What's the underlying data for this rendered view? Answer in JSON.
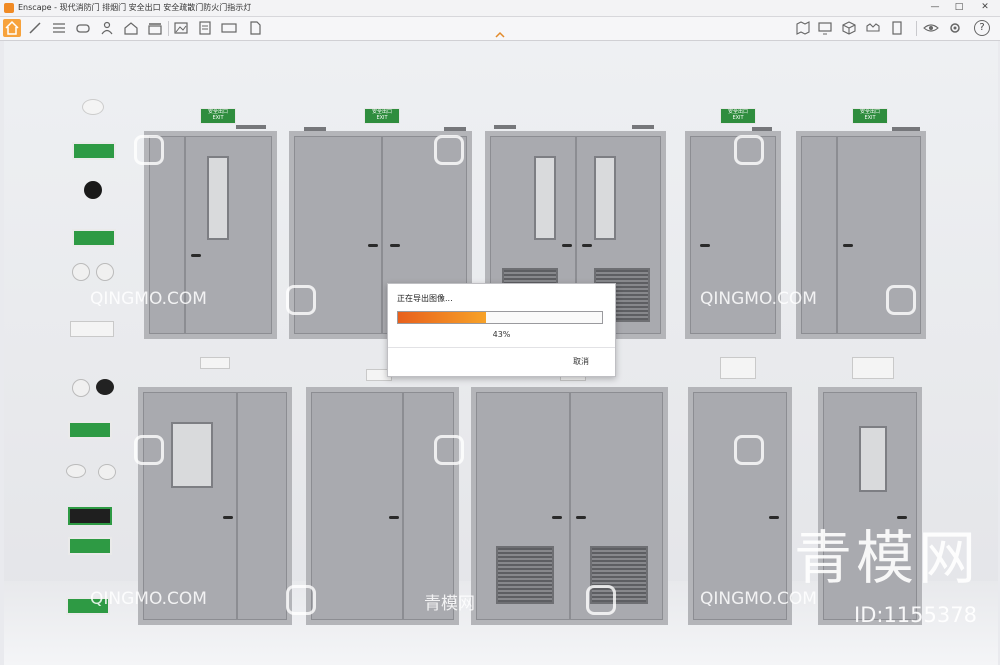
{
  "window": {
    "title": "Enscape - 现代消防门 排烟门 安全出口 安全疏散门防火门指示灯",
    "controls": [
      "—",
      "□",
      "✕"
    ]
  },
  "toolbar": {
    "left_icons": [
      "home-icon",
      "brush-icon",
      "bim-icon",
      "gamepad-icon",
      "people-icon",
      "house-icon",
      "buildings-icon",
      "clapper-icon",
      "image-export-icon",
      "batch-export-icon",
      "panorama-icon",
      "export-file-icon"
    ],
    "right_icons": [
      "map-icon",
      "monitor-icon",
      "cube-icon",
      "vr-icon",
      "building-icon",
      "eye-icon",
      "settings-icon",
      "help-icon"
    ],
    "help_label": "?",
    "accent": "#f7a23c"
  },
  "dialog": {
    "title": "正在导出图像...",
    "progress": 0.43,
    "progress_text": "43%",
    "cancel_label": "取消"
  },
  "scene": {
    "exit_sign_text": "安全出口",
    "exit_sign_sub": "EXIT"
  },
  "watermarks": {
    "site": "QINGMO.COM",
    "site_cn": "青模网",
    "big": "青模网",
    "id": "ID:1155378"
  }
}
